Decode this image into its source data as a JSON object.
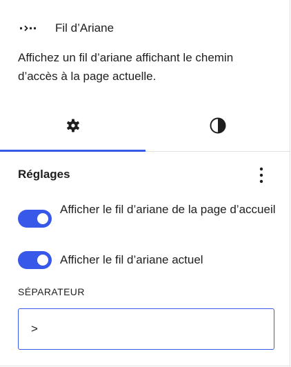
{
  "block": {
    "icon": "breadcrumbs-icon",
    "title": "Fil d’Ariane",
    "description": "Affichez un fil d’ariane affichant le chemin d’accès à la page actuelle."
  },
  "tabs": [
    {
      "name": "settings",
      "icon": "gear-icon",
      "active": true
    },
    {
      "name": "styles",
      "icon": "half-circle-contrast-icon",
      "active": false
    }
  ],
  "settings": {
    "title": "Réglages",
    "more_icon": "vertical-ellipsis-icon",
    "toggles": [
      {
        "label": "Afficher le fil d’ariane de la page d’accueil",
        "checked": true
      },
      {
        "label": "Afficher le fil d’ariane actuel",
        "checked": true
      }
    ],
    "separator_label": "SÉPARATEUR",
    "separator_value": ">"
  },
  "colors": {
    "accent": "#3858e9",
    "text": "#1e1e1e",
    "border": "#e0e0e0"
  }
}
